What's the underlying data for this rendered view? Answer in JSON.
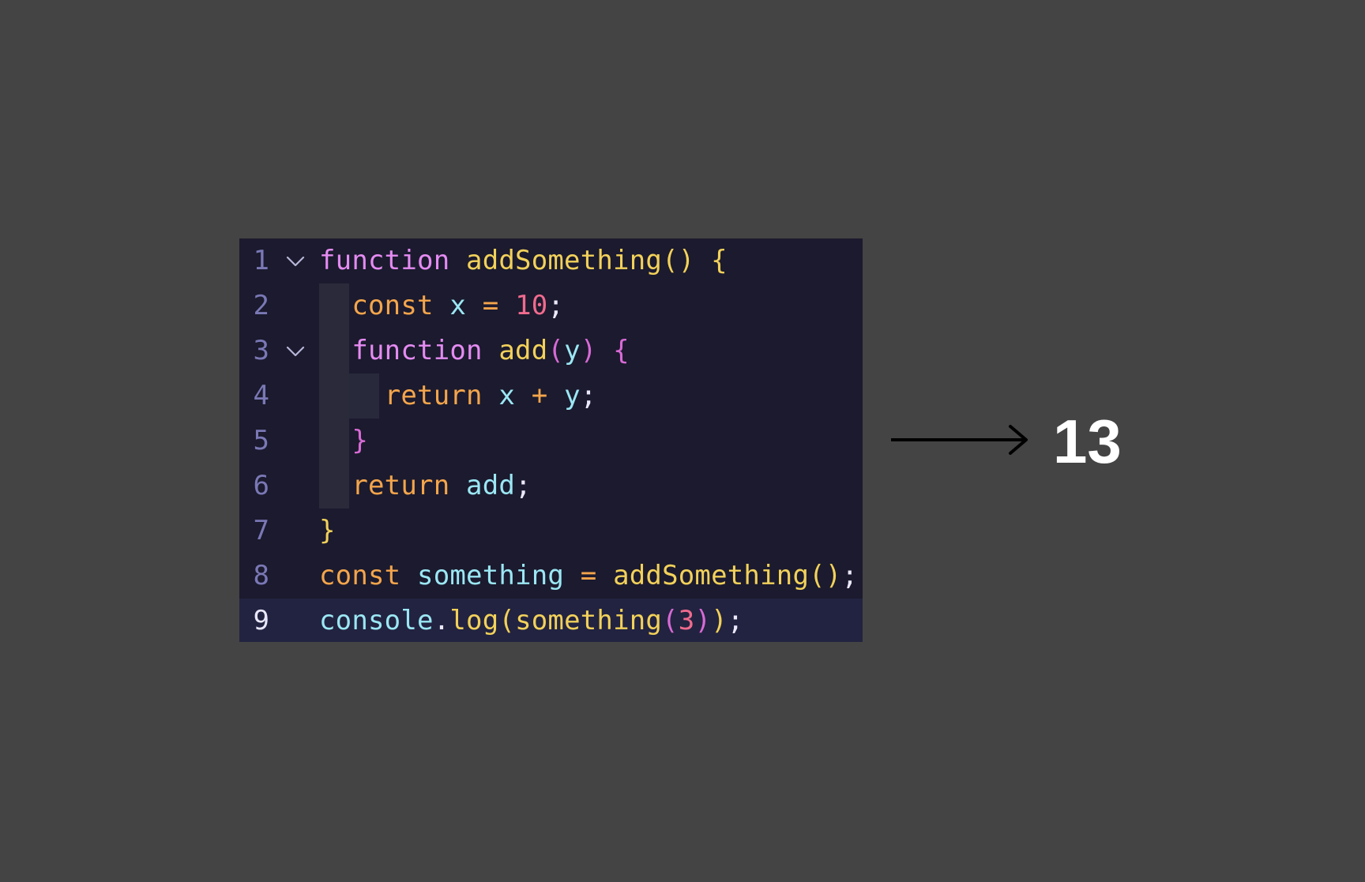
{
  "editor": {
    "lines": [
      {
        "number": "1",
        "fold": true,
        "tokens": [
          {
            "text": "function",
            "style": "k-pink"
          },
          {
            "text": " ",
            "style": "k-white"
          },
          {
            "text": "addSomething",
            "style": "k-yellow"
          },
          {
            "text": "()",
            "style": "bracket-yellow"
          },
          {
            "text": " ",
            "style": "k-white"
          },
          {
            "text": "{",
            "style": "bracket-yellow"
          }
        ]
      },
      {
        "number": "2",
        "fold": false,
        "tokens": [
          {
            "text": "  ",
            "style": "k-white"
          },
          {
            "text": "const",
            "style": "k-orange"
          },
          {
            "text": " ",
            "style": "k-white"
          },
          {
            "text": "x",
            "style": "k-cyan"
          },
          {
            "text": " = ",
            "style": "k-orange"
          },
          {
            "text": "10",
            "style": "k-red"
          },
          {
            "text": ";",
            "style": "k-white"
          }
        ]
      },
      {
        "number": "3",
        "fold": true,
        "tokens": [
          {
            "text": "  ",
            "style": "k-white"
          },
          {
            "text": "function",
            "style": "k-pink"
          },
          {
            "text": " ",
            "style": "k-white"
          },
          {
            "text": "add",
            "style": "k-yellow"
          },
          {
            "text": "(",
            "style": "bracket-pink"
          },
          {
            "text": "y",
            "style": "k-cyan"
          },
          {
            "text": ")",
            "style": "bracket-pink"
          },
          {
            "text": " ",
            "style": "k-white"
          },
          {
            "text": "{",
            "style": "bracket-pink"
          }
        ]
      },
      {
        "number": "4",
        "fold": false,
        "tokens": [
          {
            "text": "    ",
            "style": "k-white"
          },
          {
            "text": "return",
            "style": "k-orange"
          },
          {
            "text": " ",
            "style": "k-white"
          },
          {
            "text": "x",
            "style": "k-cyan"
          },
          {
            "text": " + ",
            "style": "k-orange"
          },
          {
            "text": "y",
            "style": "k-cyan"
          },
          {
            "text": ";",
            "style": "k-white"
          }
        ]
      },
      {
        "number": "5",
        "fold": false,
        "tokens": [
          {
            "text": "  ",
            "style": "k-white"
          },
          {
            "text": "}",
            "style": "bracket-pink"
          }
        ]
      },
      {
        "number": "6",
        "fold": false,
        "tokens": [
          {
            "text": "  ",
            "style": "k-white"
          },
          {
            "text": "return",
            "style": "k-orange"
          },
          {
            "text": " ",
            "style": "k-white"
          },
          {
            "text": "add",
            "style": "k-cyan"
          },
          {
            "text": ";",
            "style": "k-white"
          }
        ]
      },
      {
        "number": "7",
        "fold": false,
        "tokens": [
          {
            "text": "}",
            "style": "bracket-yellow"
          }
        ]
      },
      {
        "number": "8",
        "fold": false,
        "tokens": [
          {
            "text": "const",
            "style": "k-orange"
          },
          {
            "text": " ",
            "style": "k-white"
          },
          {
            "text": "something",
            "style": "k-cyan"
          },
          {
            "text": " = ",
            "style": "k-orange"
          },
          {
            "text": "addSomething",
            "style": "k-yellow"
          },
          {
            "text": "()",
            "style": "bracket-yellow"
          },
          {
            "text": ";",
            "style": "k-white"
          }
        ]
      },
      {
        "number": "9",
        "fold": false,
        "current": true,
        "tokens": [
          {
            "text": "console",
            "style": "k-cyan"
          },
          {
            "text": ".",
            "style": "k-white"
          },
          {
            "text": "log",
            "style": "k-yellow"
          },
          {
            "text": "(",
            "style": "bracket-yellow"
          },
          {
            "text": "something",
            "style": "k-yellow"
          },
          {
            "text": "(",
            "style": "bracket-pink"
          },
          {
            "text": "3",
            "style": "k-red"
          },
          {
            "text": ")",
            "style": "bracket-pink"
          },
          {
            "text": ")",
            "style": "bracket-yellow"
          },
          {
            "text": ";",
            "style": "k-white"
          }
        ]
      }
    ],
    "colors": {
      "background": "#1b1a2e",
      "current_line": "#222340"
    }
  },
  "result": {
    "value": "13",
    "arrow_icon": "right-arrow-icon"
  }
}
